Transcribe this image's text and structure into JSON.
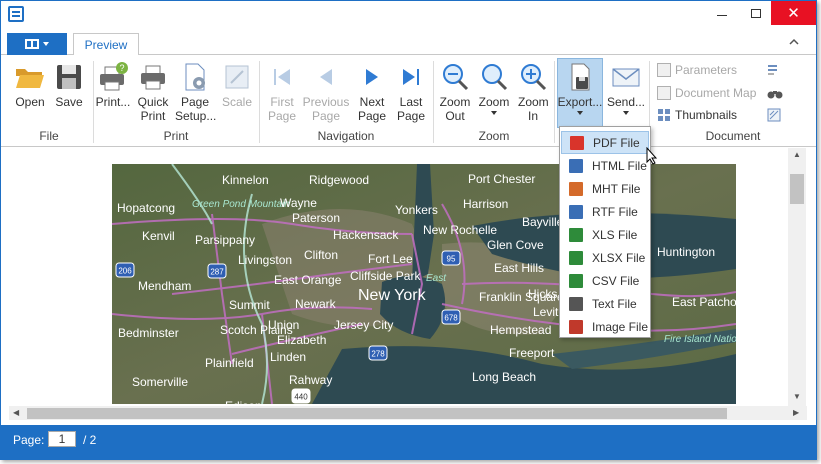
{
  "titlebar": {
    "close_glyph": "✕"
  },
  "tabs": {
    "preview": "Preview"
  },
  "ribbon": {
    "file": {
      "label": "File",
      "open": "Open",
      "save": "Save"
    },
    "print": {
      "label": "Print",
      "print": "Print...",
      "quick_print": "Quick Print",
      "page_setup": "Page Setup...",
      "scale": "Scale"
    },
    "navigation": {
      "label": "Navigation",
      "first_page": "First Page",
      "previous_page": "Previous Page",
      "next_page": "Next Page",
      "last_page": "Last Page"
    },
    "zoom": {
      "label": "Zoom",
      "zoom_out": "Zoom Out",
      "zoom": "Zoom",
      "zoom_in": "Zoom In"
    },
    "export": {
      "export": "Export...",
      "send": "Send..."
    },
    "document": {
      "label": "Document",
      "parameters": "Parameters",
      "document_map": "Document Map",
      "thumbnails": "Thumbnails"
    }
  },
  "export_menu": [
    {
      "label": "PDF File",
      "tag": "PDF",
      "color": "#d9342b"
    },
    {
      "label": "HTML File",
      "tag": "HTM",
      "color": "#3a6eb5"
    },
    {
      "label": "MHT File",
      "tag": "MHT",
      "color": "#d46a2a"
    },
    {
      "label": "RTF File",
      "tag": "RTF",
      "color": "#3a6eb5"
    },
    {
      "label": "XLS File",
      "tag": "XLS",
      "color": "#2e8b3a"
    },
    {
      "label": "XLSX File",
      "tag": "XLSX",
      "color": "#2e8b3a"
    },
    {
      "label": "CSV File",
      "tag": "CSV",
      "color": "#2e8b3a"
    },
    {
      "label": "Text File",
      "tag": "TXT",
      "color": "#555555"
    },
    {
      "label": "Image File",
      "tag": "IMG",
      "color": "#c0392b"
    }
  ],
  "map_labels": [
    "Kinnelon",
    "Ridgewood",
    "Port Chester",
    "Green Pond Mountain",
    "Wayne",
    "Harrison",
    "Hopatcong",
    "Paterson",
    "Yonkers",
    "Bayville",
    "Kenvil",
    "Parsippany",
    "Hackensack",
    "New Rochelle",
    "Livingston",
    "Clifton",
    "Fort Lee",
    "Glen Cove",
    "Huntington",
    "Mendham",
    "East Orange",
    "Cliffside Park",
    "East",
    "East Hills",
    "Hicks",
    "New York",
    "Franklin Square",
    "Levit",
    "Summit",
    "Newark",
    "Bedminster",
    "Scotch Plains",
    "Union",
    "Jersey City",
    "Elizabeth",
    "Hempstead",
    "Linden",
    "Plainfield",
    "Freeport",
    "Somerville",
    "Rahway",
    "Long Beach",
    "Edison",
    "East Patchogue",
    "Fire Island National Seashore",
    "206",
    "287",
    "95",
    "278",
    "440",
    "678"
  ],
  "status": {
    "page_label": "Page:",
    "current_page": "1",
    "total": "/ 2"
  }
}
